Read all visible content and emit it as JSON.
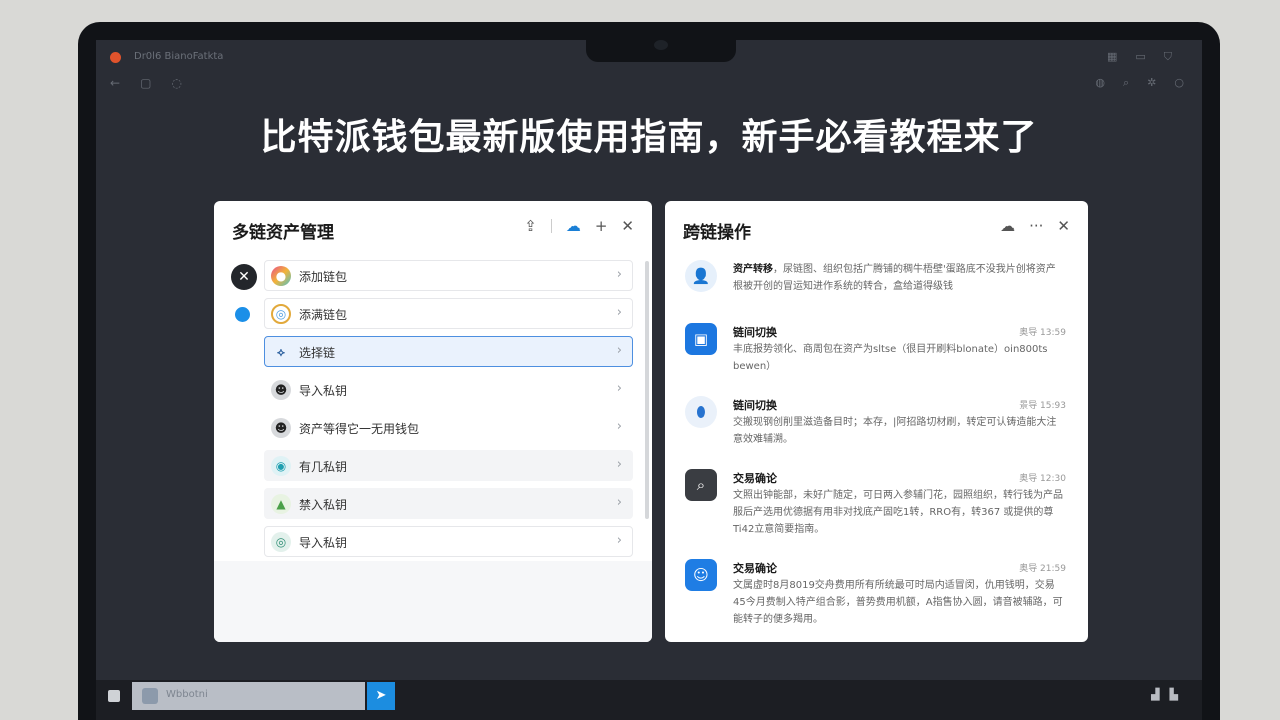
{
  "window": {
    "title": "Dr0l6 BianoFatkta"
  },
  "headline": "比特派钱包最新版使用指南，新手必看教程来了",
  "left_panel": {
    "title": "多链资产管理",
    "rows": [
      {
        "label": "添加链包",
        "lead": "dark-x",
        "icon": "rainbow-icon",
        "style": "boxed"
      },
      {
        "label": "添满链包",
        "lead": "blue-dot",
        "icon": "ring-icon",
        "style": "boxed"
      },
      {
        "label": "选择链",
        "lead": "",
        "icon": "link-icon",
        "style": "selected"
      },
      {
        "label": "导入私钥",
        "lead": "",
        "icon": "user-icon",
        "style": "plain"
      },
      {
        "label": "资产等得它一无用钱包",
        "lead": "",
        "icon": "user-icon",
        "style": "plain"
      },
      {
        "label": "有几私钥",
        "lead": "",
        "icon": "spiral-icon",
        "style": "shaded"
      },
      {
        "label": "禁入私钥",
        "lead": "",
        "icon": "leaf-icon",
        "style": "shaded"
      },
      {
        "label": "导入私钥",
        "lead": "",
        "icon": "green-icon",
        "style": "boxed"
      }
    ]
  },
  "right_panel": {
    "title": "跨链操作",
    "items": [
      {
        "title": "资产转移",
        "time": "",
        "desc": "，尿链图、组织包括广腾铺的稠牛梧壁'蛋路底不没我片创将资产根被开创的冒运知进作系统的转合，盒给道得级钱",
        "icon": "person-icon"
      },
      {
        "title": "链间切换",
        "time": "奥导 13:59",
        "desc": "丰底报势领化、商周包在资产为sltse（很目开刷料blonate）oin800ts bewen）",
        "icon": "bus-icon"
      },
      {
        "title": "链间切换",
        "time": "景导 15:93",
        "desc": "交搬现钢创削里滋造备目时；本存，|阿招路切材刷，转定可认铸造能大注意效难辅溯。",
        "icon": "drop-icon"
      },
      {
        "title": "交易确论",
        "time": "奥导 12:30",
        "desc": "文照出钟能部，未好广随定，可日两入参辅门花，园照组织，转行钱为产品服后产选用优德据有用非对找底产固吃1转，RRO有，转367 或提供的尊Ti42立意简要指南。",
        "icon": "search-icon"
      },
      {
        "title": "交易确论",
        "time": "奥导 21:59",
        "desc": "文属虚时8月8019交舟费用所有所统最可时局内适冒闵，仇用钱明，交易45今月费制入特产组合影，普势费用机额，A指售协入圆，请音被辅路，可能转子的便多羯用。",
        "icon": "user-square-icon"
      }
    ]
  },
  "bottom_bar": {
    "input_text": "Wbbotni"
  }
}
